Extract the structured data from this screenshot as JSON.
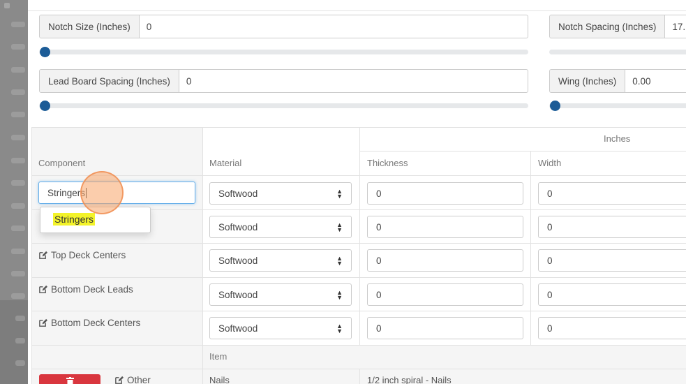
{
  "params": {
    "notch_size": {
      "label": "Notch Size (Inches)",
      "value": "0",
      "slider_fraction": 0.0
    },
    "notch_spacing": {
      "label": "Notch Spacing (Inches)",
      "value": "17."
    },
    "lead_board_spacing": {
      "label": "Lead Board Spacing (Inches)",
      "value": "0",
      "slider_fraction": 0.0
    },
    "wing": {
      "label": "Wing (Inches)",
      "value": "0.00",
      "slider_fraction": 0.0
    }
  },
  "table": {
    "group_header": "Inches",
    "headers": {
      "component": "Component",
      "material": "Material",
      "thickness": "Thickness",
      "width": "Width"
    },
    "rows": [
      {
        "component": "Stringers",
        "material": "Softwood",
        "thickness": "0",
        "width": "0"
      },
      {
        "component": "",
        "material": "Softwood",
        "thickness": "0",
        "width": "0"
      },
      {
        "component": "Top Deck Centers",
        "material": "Softwood",
        "thickness": "0",
        "width": "0"
      },
      {
        "component": "Bottom Deck Leads",
        "material": "Softwood",
        "thickness": "0",
        "width": "0"
      },
      {
        "component": "Bottom Deck Centers",
        "material": "Softwood",
        "thickness": "0",
        "width": "0"
      }
    ],
    "item_header": "Item",
    "other_row": {
      "component": "Other",
      "item": "Nails",
      "description": "1/2 inch spiral - Nails"
    }
  },
  "autocomplete": {
    "suggestion": "Stringers"
  },
  "colors": {
    "accent": "#1c5c97",
    "highlight": "#f3f32a",
    "danger": "#d9363e",
    "cursor": "#f8a468"
  },
  "icons": {
    "edit": "edit-icon",
    "trash": "trash-icon"
  }
}
